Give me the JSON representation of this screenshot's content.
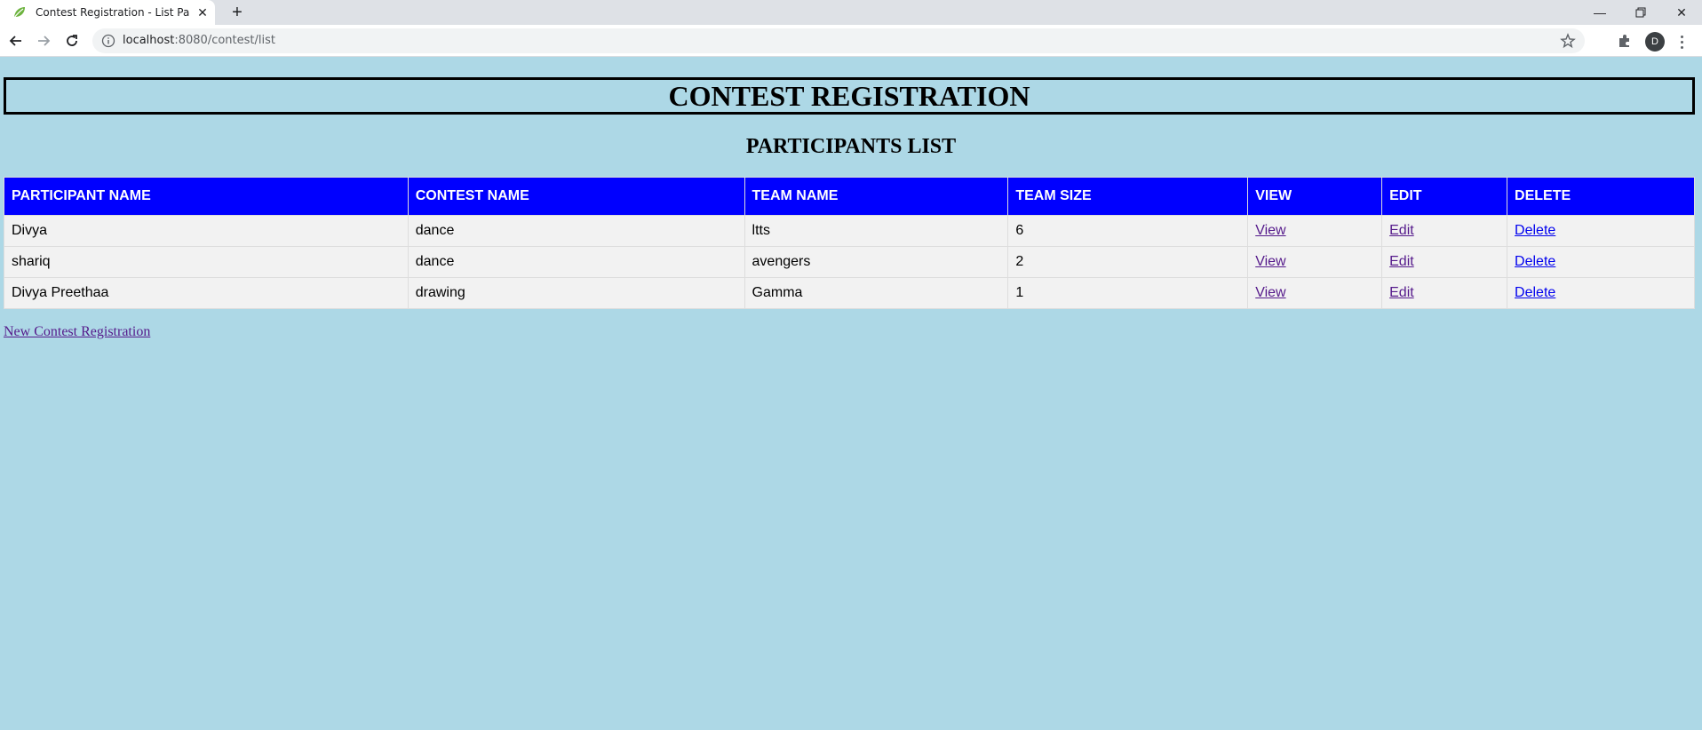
{
  "browser": {
    "tab_title": "Contest Registration - List Particip",
    "url_host": "localhost",
    "url_path": ":8080/contest/list",
    "profile_initial": "D"
  },
  "page": {
    "title": "CONTEST REGISTRATION",
    "subtitle": "PARTICIPANTS LIST",
    "columns": [
      "PARTICIPANT NAME",
      "CONTEST NAME",
      "TEAM NAME",
      "TEAM SIZE",
      "VIEW",
      "EDIT",
      "DELETE"
    ],
    "rows": [
      {
        "participant": "Divya",
        "contest": "dance",
        "team": "ltts",
        "size": "6",
        "view": "View",
        "edit": "Edit",
        "delete": "Delete"
      },
      {
        "participant": "shariq",
        "contest": "dance",
        "team": "avengers",
        "size": "2",
        "view": "View",
        "edit": "Edit",
        "delete": "Delete"
      },
      {
        "participant": "Divya Preethaa",
        "contest": "drawing",
        "team": "Gamma",
        "size": "1",
        "view": "View",
        "edit": "Edit",
        "delete": "Delete"
      }
    ],
    "new_link": "New Contest Registration"
  },
  "colors": {
    "background": "#add8e6",
    "header_row": "#0000ff",
    "row_bg": "#f2f2f2"
  }
}
